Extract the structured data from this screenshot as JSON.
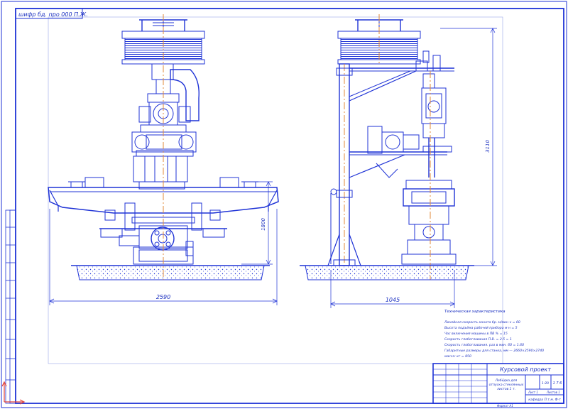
{
  "sheet": {
    "stamp_top": "шифр бд. про 000 П.Ж.",
    "line_color": "#1f33d6",
    "accent_color": "#e08a3a"
  },
  "dimensions": {
    "front_width": "2590",
    "front_height": "1800",
    "side_width": "1045",
    "side_height": "3110"
  },
  "tech": {
    "title": "Техническая характеристика",
    "lines": [
      "Линейная скорость каната бр. м/мин v = 60",
      "Высота подъёма рабочей прибора м н = 5",
      "Час включения машины в ПВ % = 15",
      "Скорость глобоглавания П.В. = 2.5 = 1",
      "Скорость глобоглавания. раз в мин. 60 = 1.60",
      "Габаритные размеры для станка, мм — 2660×2590×2740",
      "масса: кг = 850"
    ]
  },
  "titleblock": {
    "main": "Курсовой проект",
    "desc1": "Лебёдка для",
    "desc2": "отпуска стеклянных",
    "desc3": "листов 1 т.",
    "code": "1 7 6",
    "dept": "кафедра П.т.м. Ф-т",
    "sheet": "Лист 1",
    "sheets": "Листов 1",
    "scale": "1:20",
    "format": "Формат А1"
  }
}
